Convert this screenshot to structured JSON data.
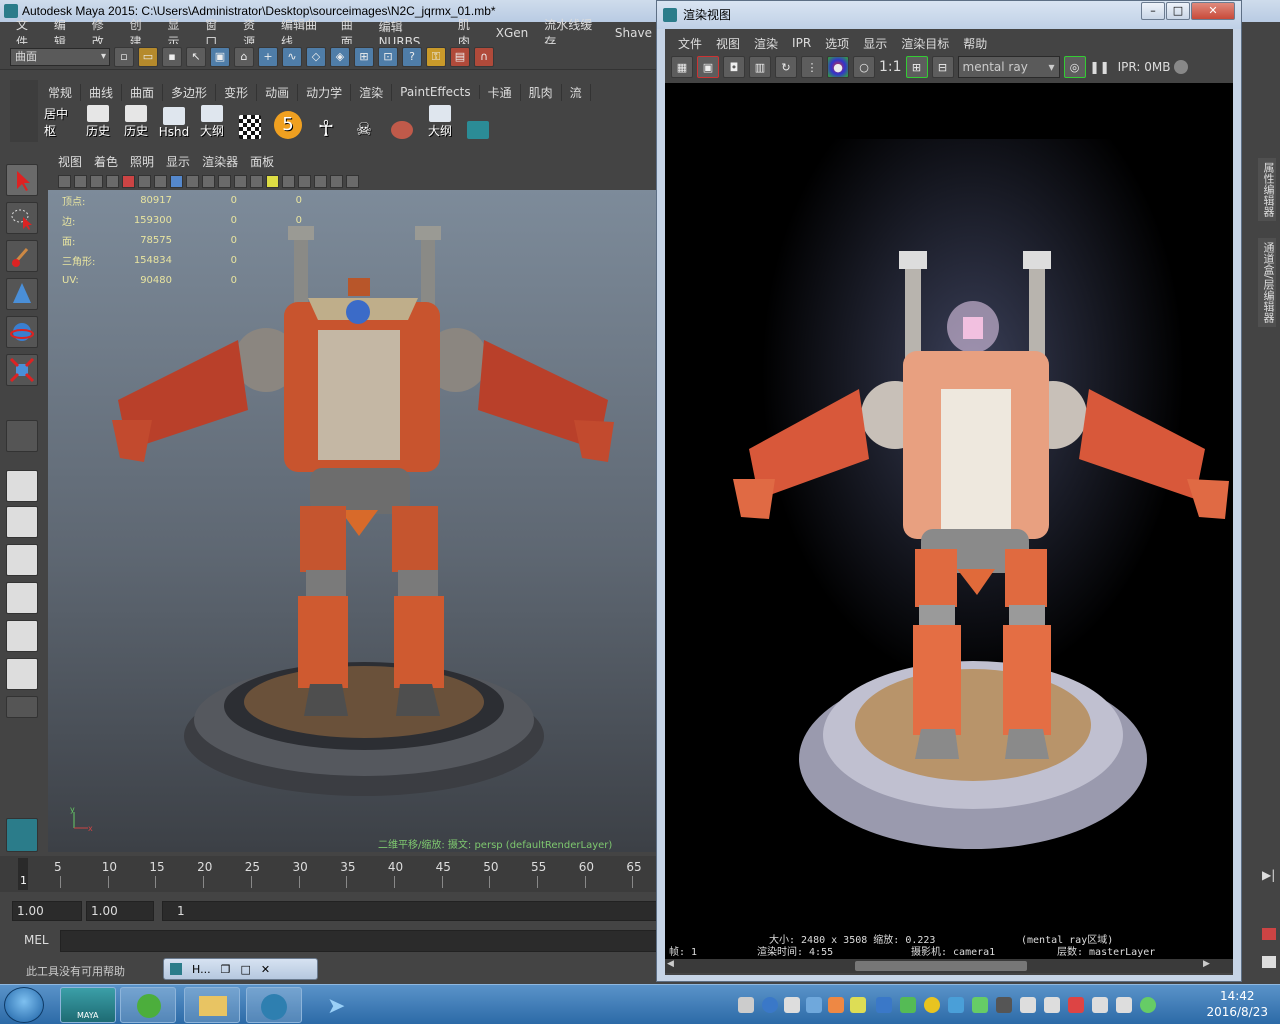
{
  "maya": {
    "title": "Autodesk Maya 2015: C:\\Users\\Administrator\\Desktop\\sourceimages\\N2C_jqrmx_01.mb*",
    "menu": [
      "文件",
      "编辑",
      "修改",
      "创建",
      "显示",
      "窗口",
      "资源",
      "编辑曲线",
      "曲面",
      "编辑 NURBS",
      "肌肉",
      "XGen",
      "流水线缓存",
      "Shave"
    ],
    "mode": "曲面",
    "shelf_tabs": [
      "常规",
      "曲线",
      "曲面",
      "多边形",
      "变形",
      "动画",
      "动力学",
      "渲染",
      "PaintEffects",
      "卡通",
      "肌肉",
      "流"
    ],
    "shelf_buttons": [
      "居中枢",
      "历史",
      "历史",
      "Hshd",
      "大纲",
      "",
      "5",
      "",
      "",
      "",
      "大纲",
      ""
    ],
    "viewport_menu": [
      "视图",
      "着色",
      "照明",
      "显示",
      "渲染器",
      "面板"
    ],
    "hud": [
      {
        "label": "顶点:",
        "v1": "80917",
        "v2": "0",
        "v3": "0"
      },
      {
        "label": "边:",
        "v1": "159300",
        "v2": "0",
        "v3": "0"
      },
      {
        "label": "面:",
        "v1": "78575",
        "v2": "0",
        "v3": "0"
      },
      {
        "label": "三角形:",
        "v1": "154834",
        "v2": "0",
        "v3": "0"
      },
      {
        "label": "UV:",
        "v1": "90480",
        "v2": "0",
        "v3": "0"
      }
    ],
    "camera_label": "二维平移/缩放: 摄文: persp (defaultRenderLayer)",
    "timeline_ticks": [
      "5",
      "10",
      "15",
      "20",
      "25",
      "30",
      "35",
      "40",
      "45",
      "50",
      "55",
      "60",
      "65"
    ],
    "current_frame": "1",
    "range_start": "1.00",
    "range_field2": "1.00",
    "range_field3": "1",
    "cmd_label": "MEL",
    "help_text": "此工具没有可用帮助",
    "mini_window_label": "H...",
    "right_tabs": [
      "属性编辑器",
      "通道盒/层编辑器"
    ]
  },
  "render_view": {
    "title": "渲染视图",
    "menu": [
      "文件",
      "视图",
      "渲染",
      "IPR",
      "选项",
      "显示",
      "渲染目标",
      "帮助"
    ],
    "ratio_label": "1:1",
    "renderer": "mental ray",
    "ipr_text": "IPR: 0MB",
    "info": {
      "size": "大小: 2480 x 3508 缩放: 0.223",
      "region": "(mental ray区域)",
      "frame": "帧: 1",
      "render_time": "渲染时间:  4:55",
      "camera": "摄影机: camera1",
      "layer": "层数: masterLayer"
    }
  },
  "taskbar": {
    "time": "14:42",
    "date": "2016/8/23",
    "maya_label": "MAYA"
  }
}
